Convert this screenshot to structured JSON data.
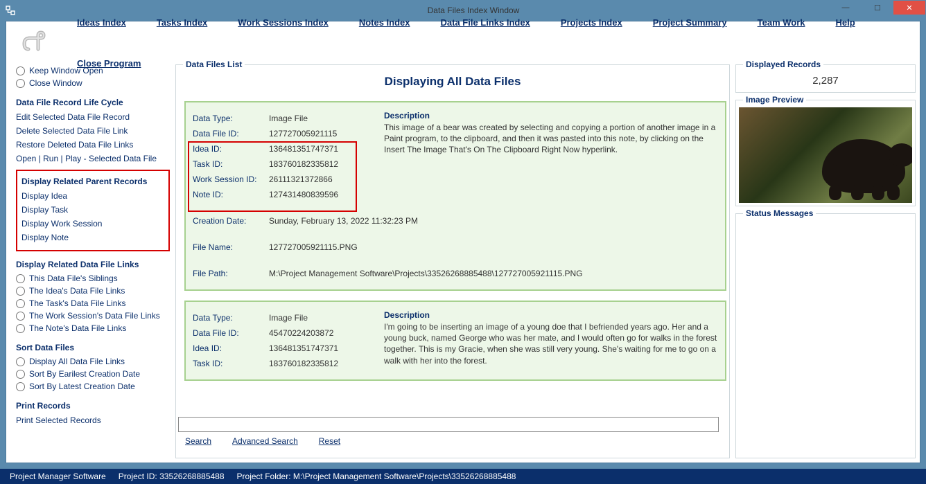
{
  "window": {
    "title": "Data Files Index Window"
  },
  "menu": {
    "items": [
      "Ideas Index",
      "Tasks Index",
      "Work Sessions Index",
      "Notes Index",
      "Data File Links Index",
      "Projects Index",
      "Project Summary",
      "Team Work",
      "Help",
      "Close Program"
    ]
  },
  "sidebar": {
    "keep_open": "Keep Window Open",
    "close_win": "Close Window",
    "lifecycle_title": "Data File Record Life Cycle",
    "lifecycle": [
      "Edit Selected Data File Record",
      "Delete Selected Data File Link",
      "Restore Deleted Data File Links",
      "Open | Run | Play - Selected Data File"
    ],
    "parent_title": "Display Related Parent Records",
    "parent": [
      "Display Idea",
      "Display Task",
      "Display Work Session",
      "Display Note"
    ],
    "links_title": "Display Related Data File Links",
    "links": [
      "This Data File's Siblings",
      "The Idea's Data File Links",
      "The Task's Data File Links",
      "The Work Session's Data File Links",
      "The Note's Data File Links"
    ],
    "sort_title": "Sort Data Files",
    "sort": [
      "Display All Data File Links",
      "Sort By Earilest Creation Date",
      "Sort By Latest Creation Date"
    ],
    "print_title": "Print Records",
    "print_link": "Print Selected Records"
  },
  "list": {
    "group_label": "Data Files List",
    "heading": "Displaying All Data Files",
    "records": [
      {
        "data_type": "Image File",
        "data_file_id": "127727005921115",
        "idea_id": "136481351747371",
        "task_id": "183760182335812",
        "work_session_id": "26111321372866",
        "note_id": "127431480839596",
        "creation_date": "Sunday, February 13, 2022   11:32:23 PM",
        "file_name": "127727005921115.PNG",
        "file_path": "M:\\Project Management Software\\Projects\\335262688854­88\\127727005921115.PNG",
        "description": "This image of a bear was created by selecting and copying a portion of another image in a Paint program, to the clipboard, and then it was pasted into this note, by clicking on the Insert The Image That's On The Clipboard Right Now hyperlink."
      },
      {
        "data_type": "Image File",
        "data_file_id": "45470224203872",
        "idea_id": "136481351747371",
        "task_id": "183760182335812",
        "description": "I'm going to be inserting an image of a young doe that I befriended years ago. Her and a young buck, named George who was her mate, and I would often go for walks in the forest together. This is my Gracie, when she was still very young. She's waiting for me to go on a walk with her into the forest."
      }
    ]
  },
  "labels": {
    "data_type": "Data Type:",
    "data_file_id": "Data File ID:",
    "idea_id": "Idea ID:",
    "task_id": "Task ID:",
    "work_session_id": "Work Session ID:",
    "note_id": "Note ID:",
    "creation_date": "Creation Date:",
    "file_name": "File Name:",
    "file_path": "File Path:",
    "description": "Description"
  },
  "right": {
    "disp_label": "Displayed Records",
    "disp_value": "2,287",
    "preview_label": "Image Preview",
    "status_label": "Status Messages"
  },
  "search": {
    "search": "Search",
    "advanced": "Advanced Search",
    "reset": "Reset"
  },
  "footer": {
    "app": "Project Manager Software",
    "project_id_label": "Project ID:",
    "project_id": "33526268885488",
    "folder_label": "Project Folder:",
    "folder": "M:\\Project Management Software\\Projects\\33526268885488"
  }
}
